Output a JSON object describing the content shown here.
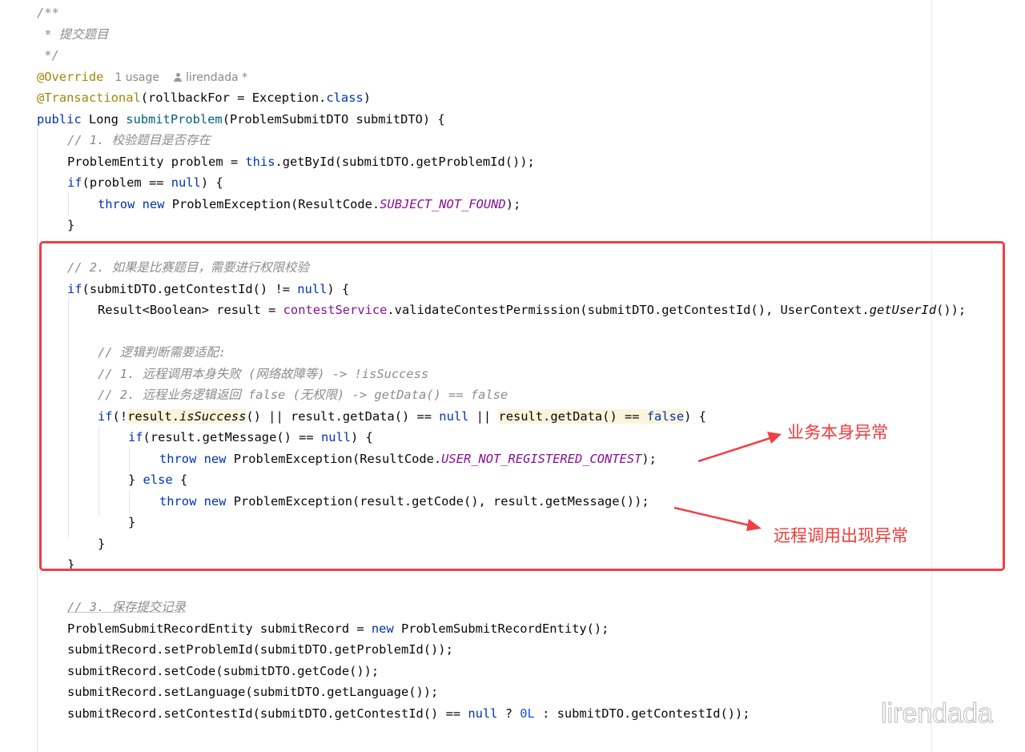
{
  "code": {
    "l1": "/**",
    "l2": " * 提交题目",
    "l3": " */",
    "ann_override": "@Override",
    "usage_hint": "1 usage",
    "author_hint": "lirendada *",
    "ann_transactional": "@Transactional",
    "tx_args_a": "(rollbackFor = Exception.",
    "tx_class": "class",
    "tx_args_b": ")",
    "kw_public": "public",
    "sig_type": " Long ",
    "method_name": "submitProblem",
    "sig_params": "(ProblemSubmitDTO submitDTO) {",
    "c1": "// 1. 校验题目是否存在",
    "l_entity_a": "ProblemEntity problem = ",
    "kw_this": "this",
    "l_entity_b": ".getById(submitDTO.getProblemId());",
    "kw_if": "if",
    "if1_a": "(problem == ",
    "kw_null": "null",
    "if1_b": ") {",
    "kw_throw": "throw",
    "kw_new": "new",
    "throw1_a": " ProblemException(ResultCode.",
    "const_not_found": "SUBJECT_NOT_FOUND",
    "throw1_b": ");",
    "close_brace": "}",
    "c2": "// 2. 如果是比赛题目，需要进行权限校验",
    "if2_a": "(submitDTO.getContestId() != ",
    "if2_b": ") {",
    "res_a": "Result<Boolean> result = ",
    "field_contest": "contestService",
    "res_b": ".validateContestPermission(submitDTO.getContestId(), UserContext.",
    "res_static": "getUserId",
    "res_c": "());",
    "c3": "// 逻辑判断需要适配:",
    "c4": "// 1. 远程调用本身失败 (网络故障等) -> !isSuccess",
    "c5": "// 2. 远程业务逻辑返回 false (无权限) -> getData() == false",
    "if3_a": "(!",
    "if3_res": "result.",
    "if3_succ": "isSuccess",
    "if3_b": "() || result.getData() == ",
    "if3_c": " || ",
    "if3_hl2": "result.getData() == ",
    "kw_false": "false",
    "if3_d": ") {",
    "if4_a": "(result.getMessage() == ",
    "if4_b": ") {",
    "const_not_registered": "USER_NOT_REGISTERED_CONTEST",
    "else_open": "} ",
    "kw_else": "else",
    "else_close": " {",
    "throw3_a": " ProblemException(result.getCode(), result.getMessage());",
    "c6": "// 3. 保存提交记录",
    "rec_a": "ProblemSubmitRecordEntity submitRecord = ",
    "rec_b": " ProblemSubmitRecordEntity();",
    "set1": "submitRecord.setProblemId(submitDTO.getProblemId());",
    "set2": "submitRecord.setCode(submitDTO.getCode());",
    "set3": "submitRecord.setLanguage(submitDTO.getLanguage());",
    "set4_a": "submitRecord.setContestId(submitDTO.getContestId() == ",
    "set4_b": " ? ",
    "num_zero": "0L",
    "set4_c": " : submitDTO.getContestId());"
  },
  "annotations": {
    "business_error": "业务本身异常",
    "remote_error": "远程调用出现异常"
  },
  "watermark": "lirendada",
  "colors": {
    "highlight_box": "#f04045",
    "annotation_text": "#f23a3a",
    "keyword": "#0033b3",
    "comment": "#8c8c8c",
    "constant": "#871094"
  }
}
